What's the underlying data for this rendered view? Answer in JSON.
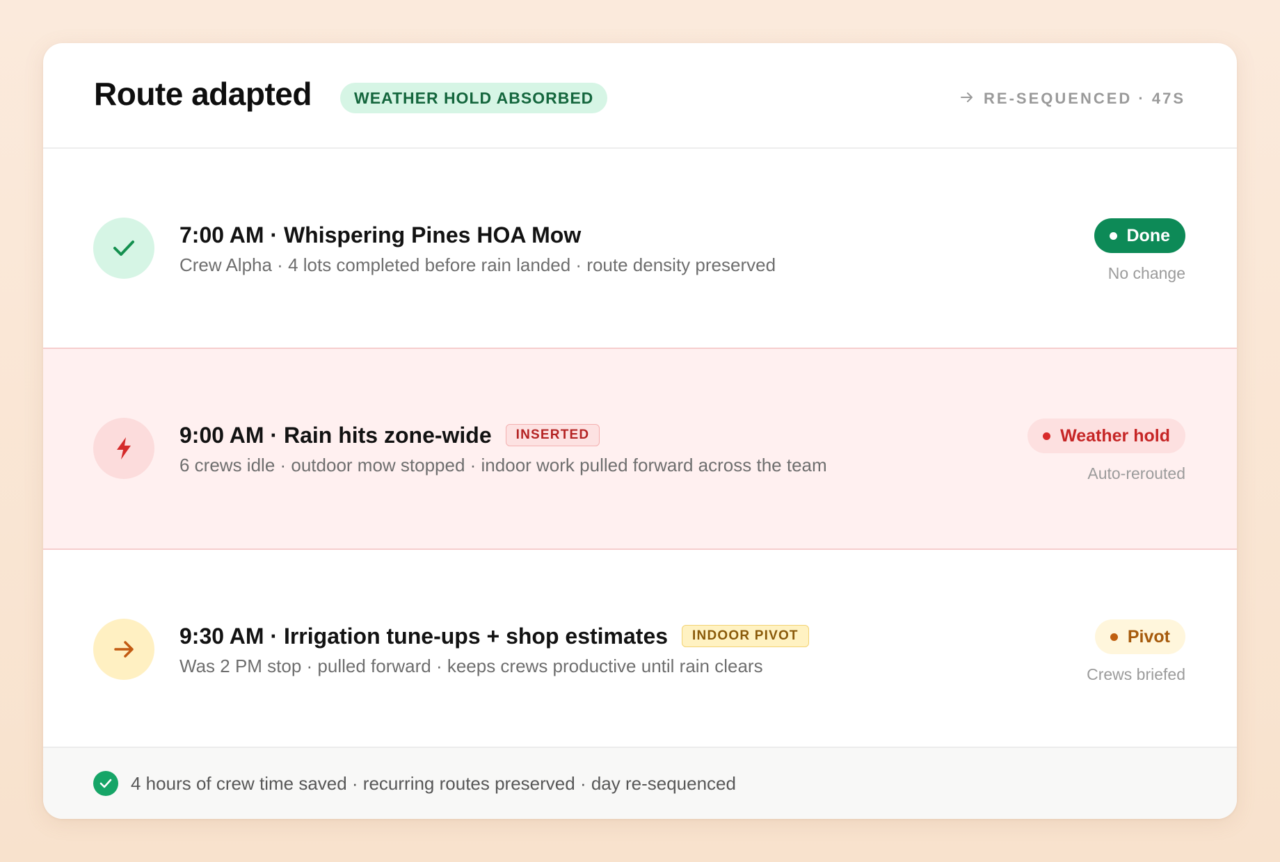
{
  "header": {
    "title": "Route adapted",
    "badge": "WEATHER HOLD ABSORBED",
    "resequenced": "RE-SEQUENCED · 47S",
    "resequenced_icon": "arrow-right-icon"
  },
  "events": [
    {
      "icon": "check-icon",
      "title": "7:00 AM · Whispering Pines HOA Mow",
      "tag": "",
      "subtitle": "Crew Alpha · 4 lots completed before rain landed · route density preserved",
      "status": "Done",
      "note": "No change"
    },
    {
      "icon": "lightning-bolt-icon",
      "title": "9:00 AM · Rain hits zone-wide",
      "tag": "INSERTED",
      "subtitle": "6 crews idle · outdoor mow stopped · indoor work pulled forward across the team",
      "status": "Weather hold",
      "note": "Auto-rerouted"
    },
    {
      "icon": "arrow-right-icon",
      "title": "9:30 AM · Irrigation tune-ups + shop estimates",
      "tag": "INDOOR PIVOT",
      "subtitle": "Was 2 PM stop · pulled forward · keeps crews productive until rain clears",
      "status": "Pivot",
      "note": "Crews briefed"
    }
  ],
  "footer": {
    "icon": "check-circle-icon",
    "text": "4 hours of crew time saved · recurring routes preserved · day re-sequenced"
  },
  "colors": {
    "done": "#0d8a57",
    "alert": "#c62626",
    "pivot": "#a65a0c",
    "badge_bg": "#d6f5e5"
  }
}
